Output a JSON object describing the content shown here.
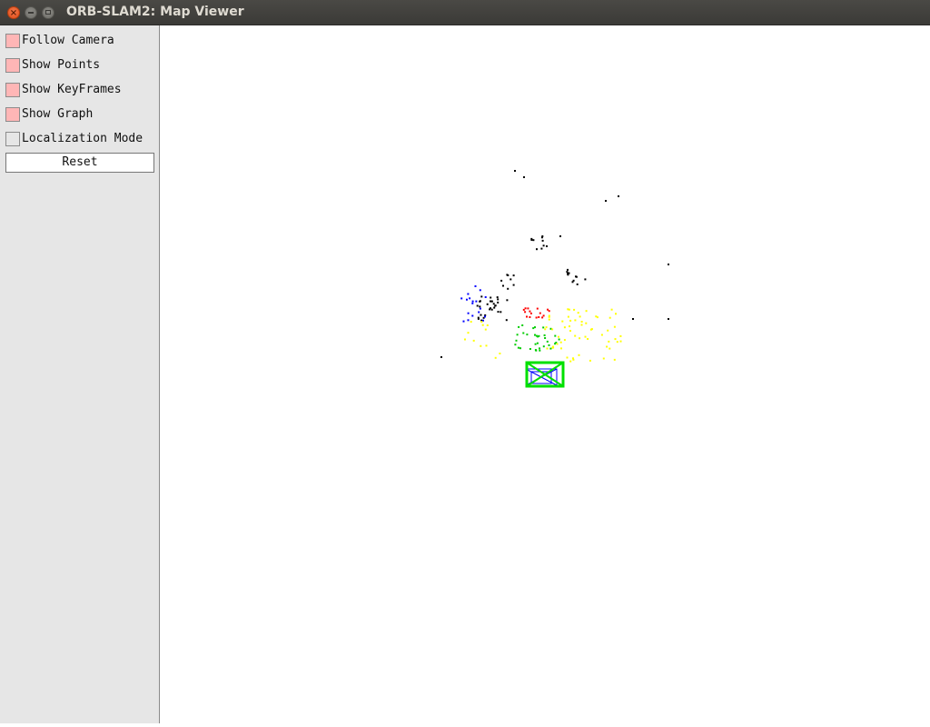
{
  "window": {
    "title": "ORB-SLAM2: Map Viewer",
    "close_glyph": "×"
  },
  "panel": {
    "options": [
      {
        "label": "Follow Camera",
        "checked": true
      },
      {
        "label": "Show Points",
        "checked": true
      },
      {
        "label": "Show KeyFrames",
        "checked": true
      },
      {
        "label": "Show Graph",
        "checked": true
      },
      {
        "label": "Localization Mode",
        "checked": false
      }
    ],
    "reset_label": "Reset",
    "checked_color": "#ffb6b6"
  },
  "map": {
    "point_colors": [
      "#000000",
      "#0000ff",
      "#ff0000",
      "#00cc00",
      "#ffff00"
    ],
    "current_camera_color": "#00e000",
    "keyframe_color": "#0000ff"
  }
}
